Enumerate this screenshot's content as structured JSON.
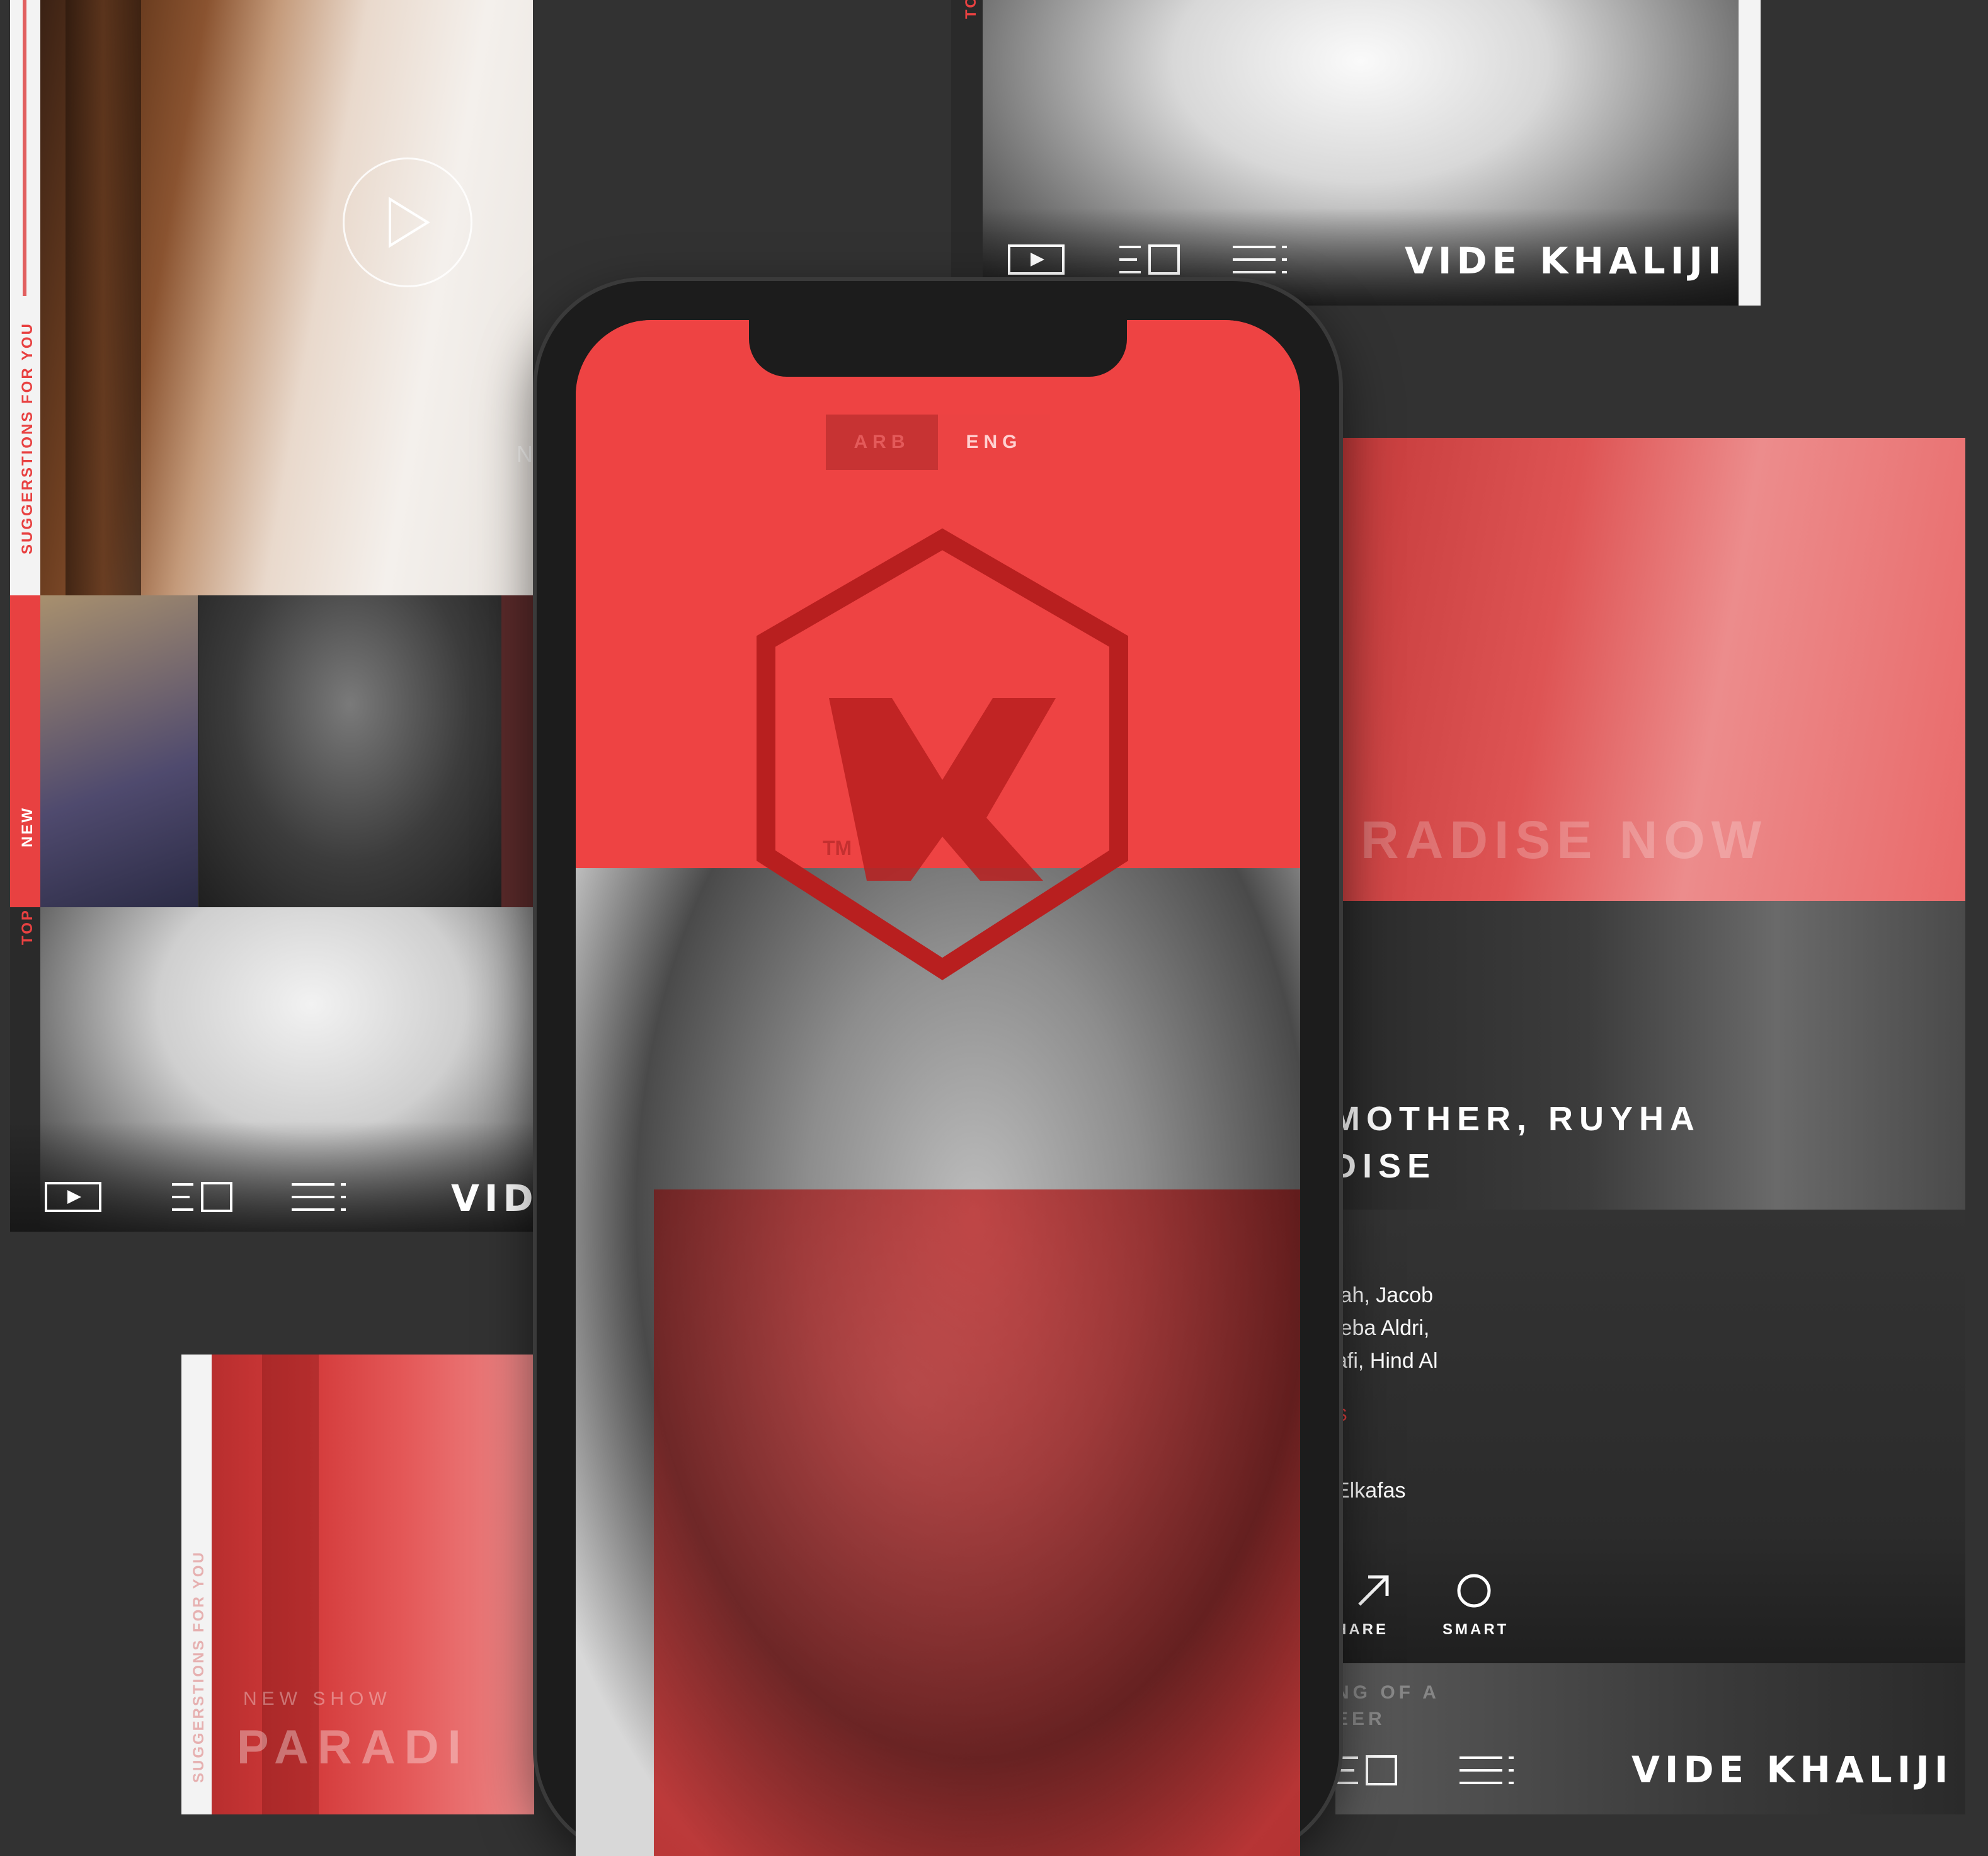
{
  "colors": {
    "accent": "#e84141",
    "background": "#323232",
    "dark_panel": "#2b2b2b"
  },
  "brand": {
    "name": "VIDE KHALIJI"
  },
  "left_panel": {
    "rail_labels": {
      "suggestions": "SUGGERSTIONS FOR YOU",
      "new": "NEW",
      "top": "TOP"
    },
    "overlay_text": "NE",
    "icons": [
      "play-icon",
      "episodes-icon",
      "menu-icon"
    ],
    "brand_partial": "VID"
  },
  "top_right_panel": {
    "rail_label": "TO",
    "icons": [
      "play-icon",
      "episodes-icon",
      "menu-icon"
    ],
    "brand": "VIDE KHALIJI"
  },
  "bottom_left_panel": {
    "rail_label": "SUGGERSTIONS FOR YOU",
    "title_small": "NEW SHOW",
    "title_big": "PARADI"
  },
  "phone": {
    "language": {
      "arb": "ARB",
      "eng": "ENG",
      "selected": "ENG"
    },
    "logo_mark": "VK",
    "tm": "TM"
  },
  "right_panel": {
    "overlay_title": "RADISE NOW",
    "title_line1": "MOTHER, RUYHA",
    "title_line2": "DISE",
    "cast_lines": [
      "lah, Jacob",
      "leba Aldri,",
      "afi, Hind Al"
    ],
    "director_label": "S",
    "director": "Elkafas",
    "actions": [
      {
        "icon": "share-icon",
        "label": "HARE"
      },
      {
        "icon": "smart-icon",
        "label": "SMART"
      }
    ],
    "next_title_line1": "NG OF A",
    "next_title_line2": "EER",
    "icons": [
      "episodes-icon",
      "menu-icon"
    ],
    "brand": "VIDE KHALIJI"
  }
}
